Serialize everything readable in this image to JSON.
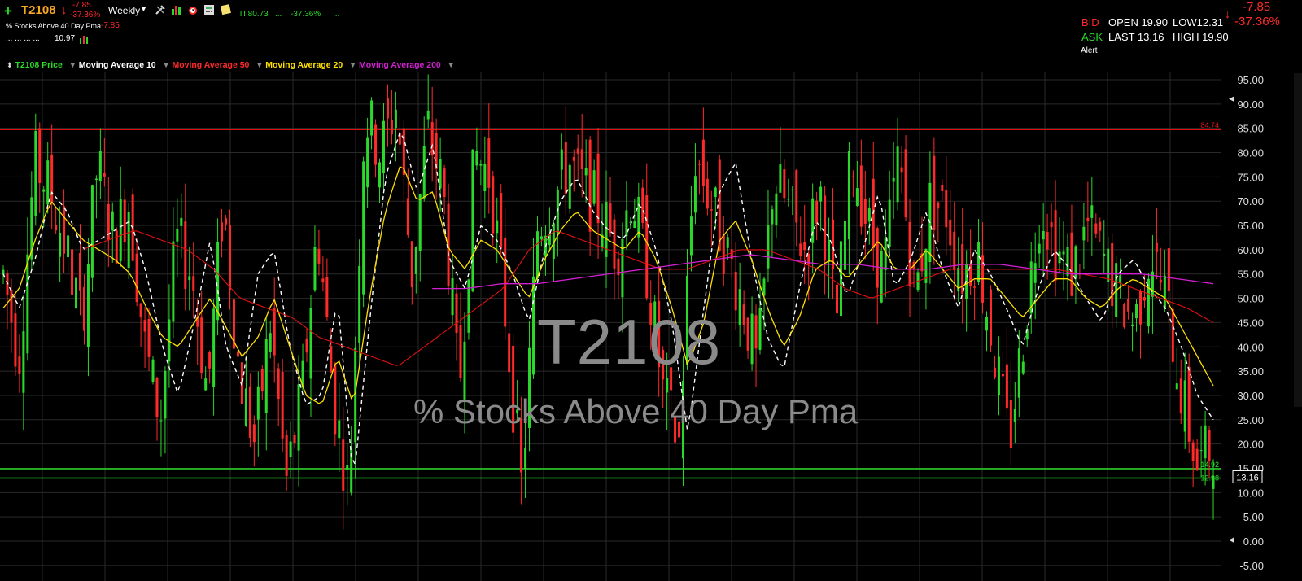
{
  "header": {
    "symbol": "T2108",
    "arrow": "↓",
    "change": "-7.85",
    "change_pct": "-37.36%",
    "interval": "Weekly",
    "ti_text": "TI 80.73",
    "ti_dots": "...",
    "ti_pct": "-37.36%",
    "ti_dots2": "...",
    "description": "% Stocks Above 40 Day Pma",
    "desc_change": "-7.85",
    "row3_dots": "... ... ... ...",
    "row3_value": "10.97"
  },
  "quote": {
    "bid_label": "BID",
    "ask_label": "ASK",
    "open": "OPEN 19.90",
    "low": "LOW12.31",
    "last": "LAST 13.16",
    "high": "HIGH 19.90",
    "change": "-7.85",
    "arrow": "↓",
    "change_pct": "-37.36%",
    "alert": "Alert"
  },
  "legend": {
    "price": "T2108 Price",
    "ma10": "Moving Average 10",
    "ma50": "Moving Average 50",
    "ma20": "Moving Average 20",
    "ma200": "Moving Average 200"
  },
  "colors": {
    "up": "#2bd92b",
    "down": "#ff2a2a",
    "ma10": "#ffffff",
    "ma20": "#ffe000",
    "ma50": "#e01010",
    "ma200": "#d020d0",
    "hline_red": "#e01010",
    "hline_green": "#2bd92b"
  },
  "chart_data": {
    "type": "candlestick",
    "title": "T2108",
    "subtitle": "% Stocks Above 40 Day Pma",
    "ylim": [
      -5,
      97
    ],
    "yticks": [
      "95.00",
      "90.00",
      "85.00",
      "80.00",
      "75.00",
      "70.00",
      "65.00",
      "60.00",
      "55.00",
      "50.00",
      "45.00",
      "40.00",
      "35.00",
      "30.00",
      "25.00",
      "20.00",
      "15.00",
      "10.00",
      "5.00",
      "0.00",
      "-5.00"
    ],
    "hlines": [
      {
        "value": 84.74,
        "label": "84.74",
        "color": "red"
      },
      {
        "value": 14.92,
        "label": "14.92",
        "color": "green"
      },
      {
        "value": 12.98,
        "label": "12.98",
        "color": "green"
      }
    ],
    "last_price_label": "13.16",
    "last_price": 13.16,
    "series_keypoints": [
      {
        "name": "T2108 Price",
        "values": [
          55,
          38,
          78,
          72,
          60,
          45,
          78,
          62,
          70,
          40,
          25,
          62,
          55,
          30,
          70,
          35,
          20,
          45,
          12,
          30,
          65,
          30,
          10,
          88,
          80,
          90,
          55,
          85,
          72,
          30,
          80,
          75,
          45,
          10,
          65,
          70,
          78,
          72,
          68,
          60,
          72,
          55,
          30,
          20,
          80,
          70,
          60,
          50,
          35,
          75,
          68,
          60,
          72,
          45,
          80,
          65,
          55,
          80,
          50,
          70,
          68,
          55,
          60,
          40,
          20,
          45,
          70,
          60,
          55,
          65,
          58,
          50,
          45,
          60,
          50,
          30,
          15,
          20
        ]
      },
      {
        "name": "Moving Average 10",
        "values": [
          55,
          48,
          58,
          72,
          68,
          60,
          62,
          64,
          66,
          55,
          40,
          30,
          45,
          62,
          40,
          32,
          55,
          60,
          40,
          28,
          30,
          50,
          12,
          45,
          75,
          85,
          72,
          82,
          58,
          52,
          65,
          62,
          55,
          45,
          60,
          70,
          75,
          68,
          64,
          62,
          70,
          60,
          45,
          22,
          48,
          72,
          78,
          58,
          42,
          35,
          52,
          66,
          62,
          50,
          60,
          72,
          52,
          58,
          68,
          56,
          48,
          60,
          55,
          48,
          40,
          52,
          60,
          56,
          50,
          45,
          55,
          58,
          52,
          48,
          40,
          30,
          25
        ]
      },
      {
        "name": "Moving Average 20",
        "values": [
          48,
          52,
          62,
          70,
          66,
          62,
          60,
          58,
          55,
          48,
          42,
          40,
          45,
          50,
          44,
          38,
          42,
          50,
          40,
          30,
          28,
          38,
          28,
          50,
          68,
          78,
          70,
          72,
          60,
          56,
          62,
          60,
          55,
          50,
          58,
          64,
          68,
          64,
          62,
          60,
          64,
          58,
          48,
          36,
          45,
          62,
          66,
          58,
          48,
          40,
          46,
          56,
          58,
          54,
          58,
          62,
          56,
          56,
          60,
          56,
          52,
          54,
          54,
          50,
          46,
          50,
          54,
          54,
          50,
          48,
          52,
          54,
          52,
          50,
          44,
          38,
          32
        ]
      },
      {
        "name": "Moving Average 50",
        "values": [
          null,
          null,
          null,
          60,
          62,
          64,
          62,
          60,
          56,
          50,
          48,
          46,
          42,
          40,
          38,
          36,
          40,
          44,
          48,
          52,
          60,
          64,
          62,
          60,
          58,
          56,
          56,
          58,
          60,
          60,
          58,
          56,
          52,
          50,
          52,
          54,
          56,
          56,
          56,
          56,
          56,
          55,
          54,
          52,
          50,
          48,
          45
        ]
      },
      {
        "name": "Moving Average 200",
        "values": [
          null,
          null,
          null,
          null,
          null,
          null,
          null,
          null,
          null,
          null,
          null,
          null,
          52,
          52,
          53,
          53,
          54,
          55,
          56,
          57,
          58,
          59,
          58,
          57,
          57,
          56,
          56,
          57,
          57,
          56,
          55,
          55,
          55,
          54,
          53
        ]
      }
    ]
  }
}
